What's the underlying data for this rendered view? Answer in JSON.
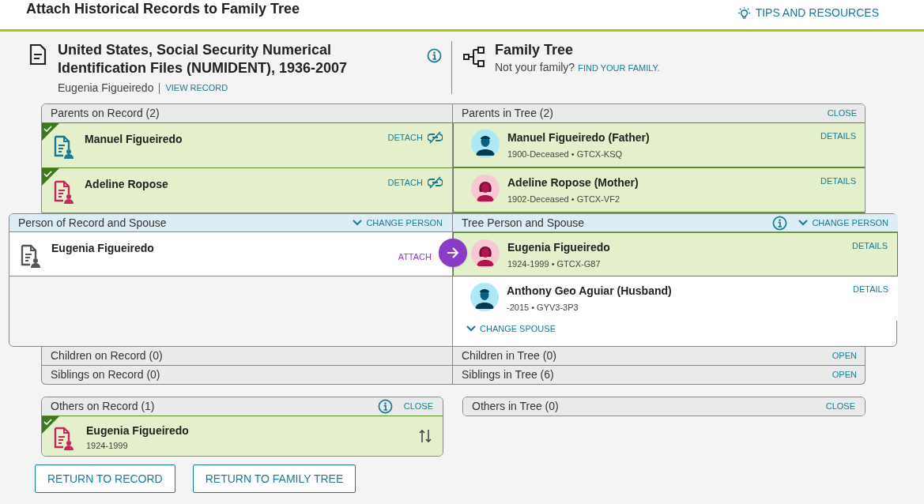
{
  "header": {
    "title": "Attach Historical Records to Family Tree",
    "tips": "TIPS AND RESOURCES"
  },
  "record": {
    "title": "United States, Social Security Numerical Identification Files (NUMIDENT), 1936-2007",
    "person": "Eugenia Figueiredo",
    "link": "VIEW RECORD"
  },
  "tree": {
    "title": "Family Tree",
    "prompt": "Not your family?",
    "link": "FIND YOUR FAMILY."
  },
  "parents": {
    "record_heading": "Parents on Record (2)",
    "tree_heading": "Parents in Tree (2)",
    "tree_action": "CLOSE",
    "record_rows": [
      {
        "name": "Manuel Figueiredo",
        "kind": "male",
        "attached": true,
        "action": "DETACH"
      },
      {
        "name": "Adeline Ropose",
        "kind": "female",
        "attached": true,
        "action": "DETACH"
      }
    ],
    "tree_rows": [
      {
        "name": "Manuel Figueiredo (Father)",
        "details": "1900-Deceased • GTCX-KSQ",
        "kind": "male",
        "action": "DETAILS"
      },
      {
        "name": "Adeline Ropose (Mother)",
        "details": "1902-Deceased • GTCX-VF2",
        "kind": "female",
        "action": "DETAILS"
      }
    ]
  },
  "spouse": {
    "record_heading": "Person of Record and Spouse",
    "record_action": "CHANGE PERSON",
    "record_person": {
      "name": "Eugenia Figueiredo",
      "action": "ATTACH"
    },
    "tree_heading": "Tree Person and Spouse",
    "tree_action": "CHANGE PERSON",
    "tree_rows": [
      {
        "name": "Eugenia Figueiredo",
        "details": "1924-1999 • GTCX-G87",
        "kind": "female",
        "selected": true,
        "action": "DETAILS"
      },
      {
        "name": "Anthony Geo Aguiar (Husband)",
        "details": "-2015 • GYV3-3P3",
        "kind": "male",
        "selected": false,
        "action": "DETAILS"
      }
    ],
    "change_spouse": "CHANGE SPOUSE"
  },
  "collapsed": [
    {
      "record_heading": "Children on Record (0)",
      "tree_heading": "Children in Tree (0)",
      "tree_action": "OPEN"
    },
    {
      "record_heading": "Siblings on Record (0)",
      "tree_heading": "Siblings in Tree (6)",
      "tree_action": "OPEN"
    }
  ],
  "others": {
    "record_heading": "Others on Record (1)",
    "record_action": "CLOSE",
    "record_rows": [
      {
        "name": "Eugenia Figueiredo",
        "details": "1924-1999",
        "kind": "female",
        "attached": true
      }
    ],
    "tree_heading": "Others in Tree (0)",
    "tree_action": "CLOSE"
  },
  "buttons": [
    "RETURN TO RECORD",
    "RETURN TO FAMILY TREE"
  ]
}
